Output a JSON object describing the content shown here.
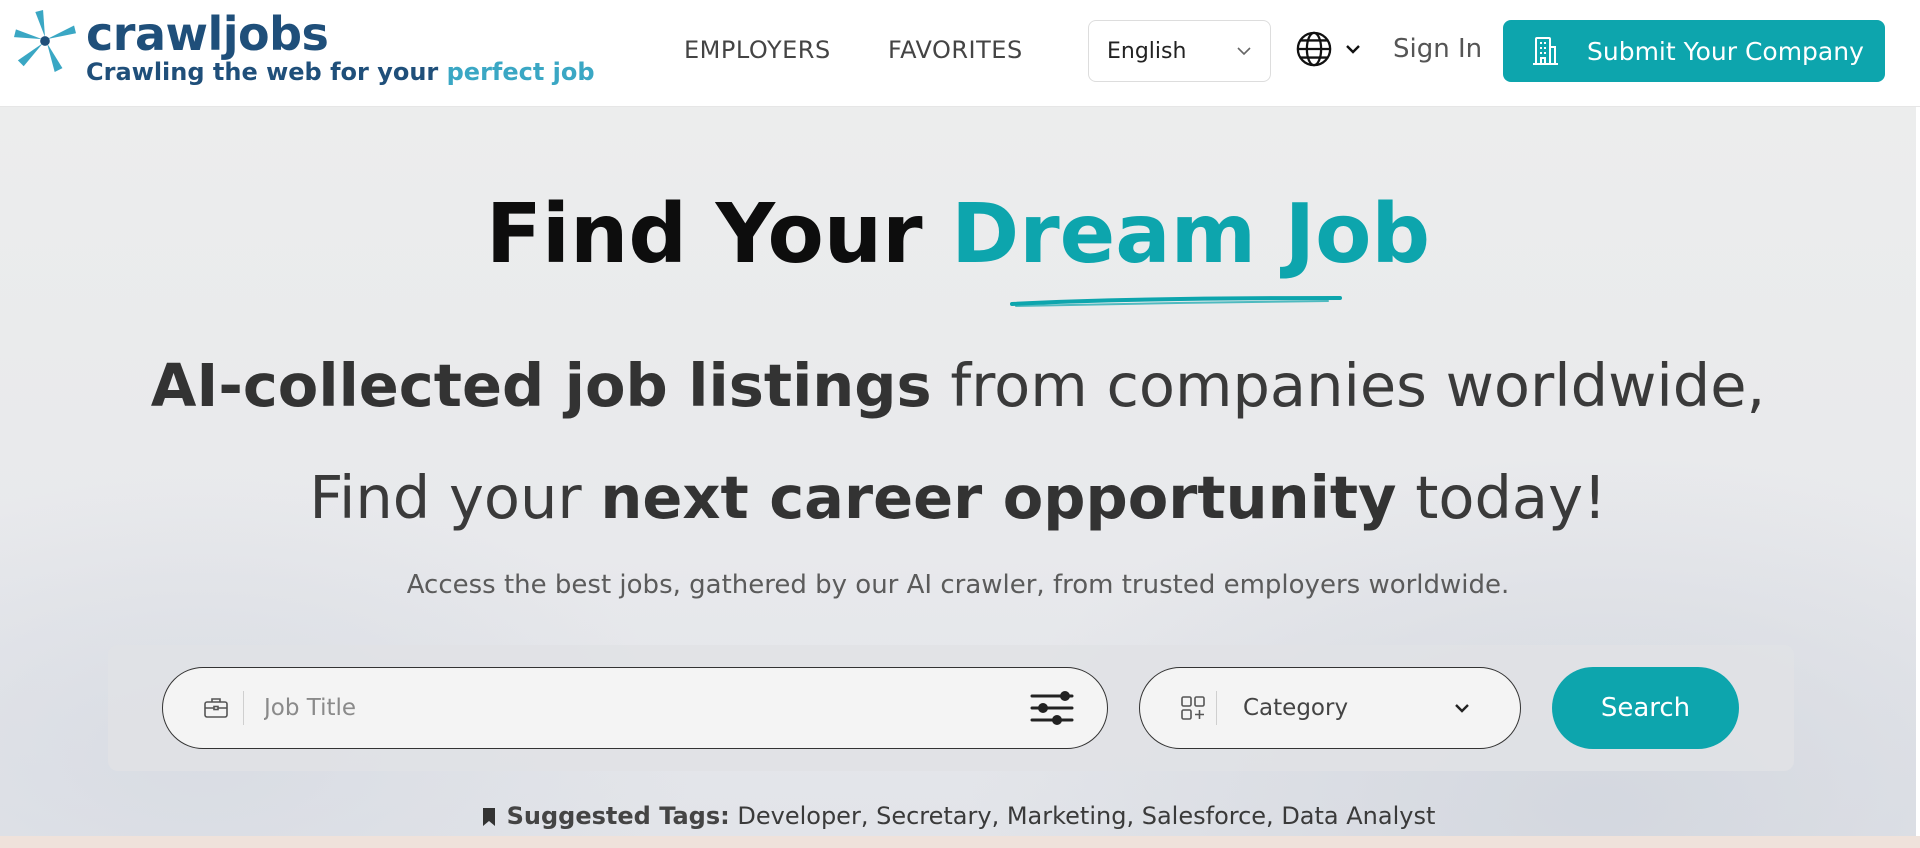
{
  "header": {
    "logo": {
      "name": "crawljobs",
      "tagline_prefix": "Crawling the web for your ",
      "tagline_accent": "perfect job"
    },
    "nav": [
      {
        "label": "EMPLOYERS"
      },
      {
        "label": "FAVORITES"
      }
    ],
    "language": {
      "selected": "English"
    },
    "globe_icon": "globe-icon",
    "sign_in_label": "Sign In",
    "submit_label": "Submit Your Company"
  },
  "hero": {
    "title_prefix": "Find Your ",
    "title_accent": "Dream Job",
    "line1_bold": "AI-collected job listings",
    "line1_rest": " from companies worldwide,",
    "line2_pre": "Find your ",
    "line2_bold": "next career opportunity",
    "line2_post": " today!",
    "description": "Access the best jobs, gathered by our AI crawler, from trusted employers worldwide."
  },
  "search": {
    "job_placeholder": "Job Title",
    "job_value": "",
    "category_label": "Category",
    "button_label": "Search"
  },
  "tags": {
    "label": "Suggested Tags:",
    "items": [
      "Developer",
      "Secretary",
      "Marketing",
      "Salesforce",
      "Data Analyst"
    ],
    "separator": ", "
  },
  "colors": {
    "brand_teal": "#0da5ad",
    "logo_navy": "#1f4f7a",
    "logo_accent": "#3aa7c4"
  }
}
